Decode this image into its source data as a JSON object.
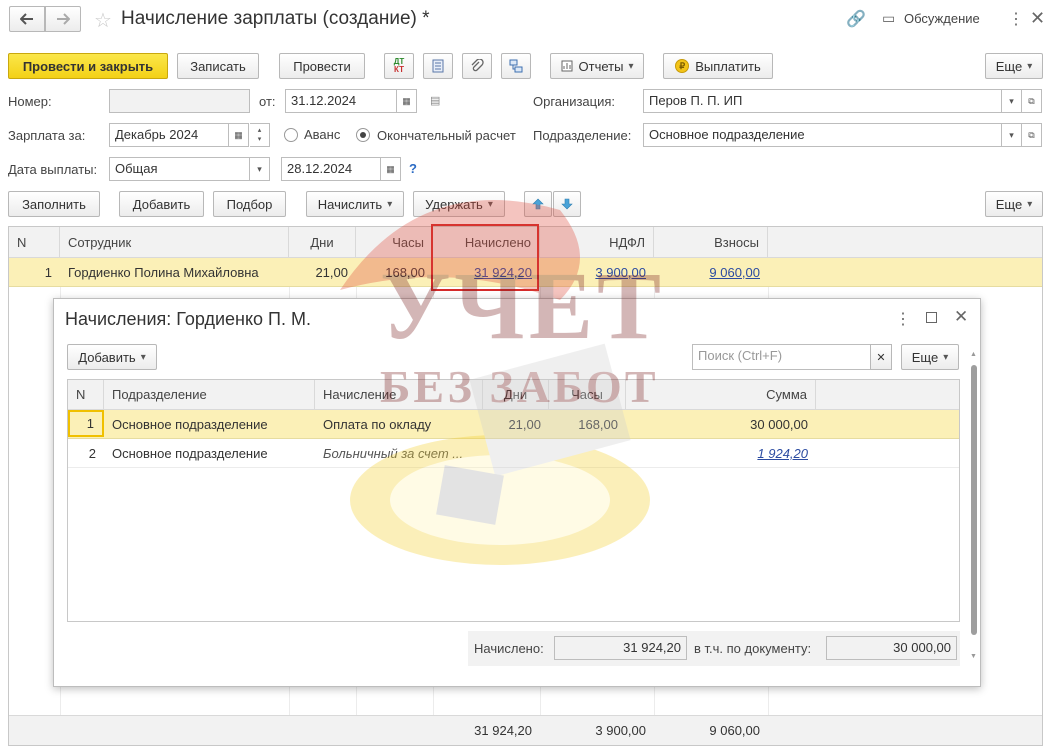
{
  "window": {
    "title": "Начисление зарплаты (создание) *",
    "discussion": "Обсуждение"
  },
  "toolbar": {
    "post_close": "Провести и закрыть",
    "save": "Записать",
    "post": "Провести",
    "reports": "Отчеты",
    "pay": "Выплатить",
    "more": "Еще"
  },
  "form": {
    "number_label": "Номер:",
    "number_value": "",
    "date_label": "от:",
    "date_value": "31.12.2024",
    "org_label": "Организация:",
    "org_value": "Перов П. П. ИП",
    "salary_for_label": "Зарплата за:",
    "salary_for_value": "Декабрь 2024",
    "radio_advance": "Аванс",
    "radio_final": "Окончательный расчет",
    "dept_label": "Подразделение:",
    "dept_value": "Основное подразделение",
    "pay_date_label": "Дата выплаты:",
    "pay_date_type": "Общая",
    "pay_date_value": "28.12.2024",
    "help": "?"
  },
  "table_toolbar": {
    "fill": "Заполнить",
    "add": "Добавить",
    "select": "Подбор",
    "accrue": "Начислить",
    "withhold": "Удержать",
    "more": "Еще"
  },
  "main_table": {
    "headers": [
      "N",
      "Сотрудник",
      "Дни",
      "Часы",
      "Начислено",
      "НДФЛ",
      "Взносы"
    ],
    "rows": [
      {
        "n": "1",
        "employee": "Гордиенко Полина Михайловна",
        "days": "21,00",
        "hours": "168,00",
        "accrued": "31 924,20",
        "ndfl": "3 900,00",
        "contrib": "9 060,00"
      }
    ],
    "footer": {
      "accrued": "31 924,20",
      "ndfl": "3 900,00",
      "contrib": "9 060,00"
    }
  },
  "dialog": {
    "title": "Начисления: Гордиенко П. М.",
    "add": "Добавить",
    "search_placeholder": "Поиск (Ctrl+F)",
    "more": "Еще",
    "headers": [
      "N",
      "Подразделение",
      "Начисление",
      "Дни",
      "Часы",
      "Сумма"
    ],
    "rows": [
      {
        "n": "1",
        "dept": "Основное подразделение",
        "accrual": "Оплата по окладу",
        "days": "21,00",
        "hours": "168,00",
        "sum": "30 000,00"
      },
      {
        "n": "2",
        "dept": "Основное подразделение",
        "accrual": "Больничный за счет ...",
        "days": "",
        "hours": "",
        "sum": "1 924,20"
      }
    ],
    "total_label": "Начислено:",
    "total_value": "31 924,20",
    "doc_label": "в т.ч. по документу:",
    "doc_value": "30 000,00"
  },
  "watermark": {
    "line1": "УЧЕТ",
    "line2": "БЕЗ ЗАБОТ"
  },
  "colors": {
    "primary": "#f5d824",
    "row_selected": "#fbf0b7",
    "highlight_box": "#d42a2a",
    "link": "#2b4ba1"
  }
}
